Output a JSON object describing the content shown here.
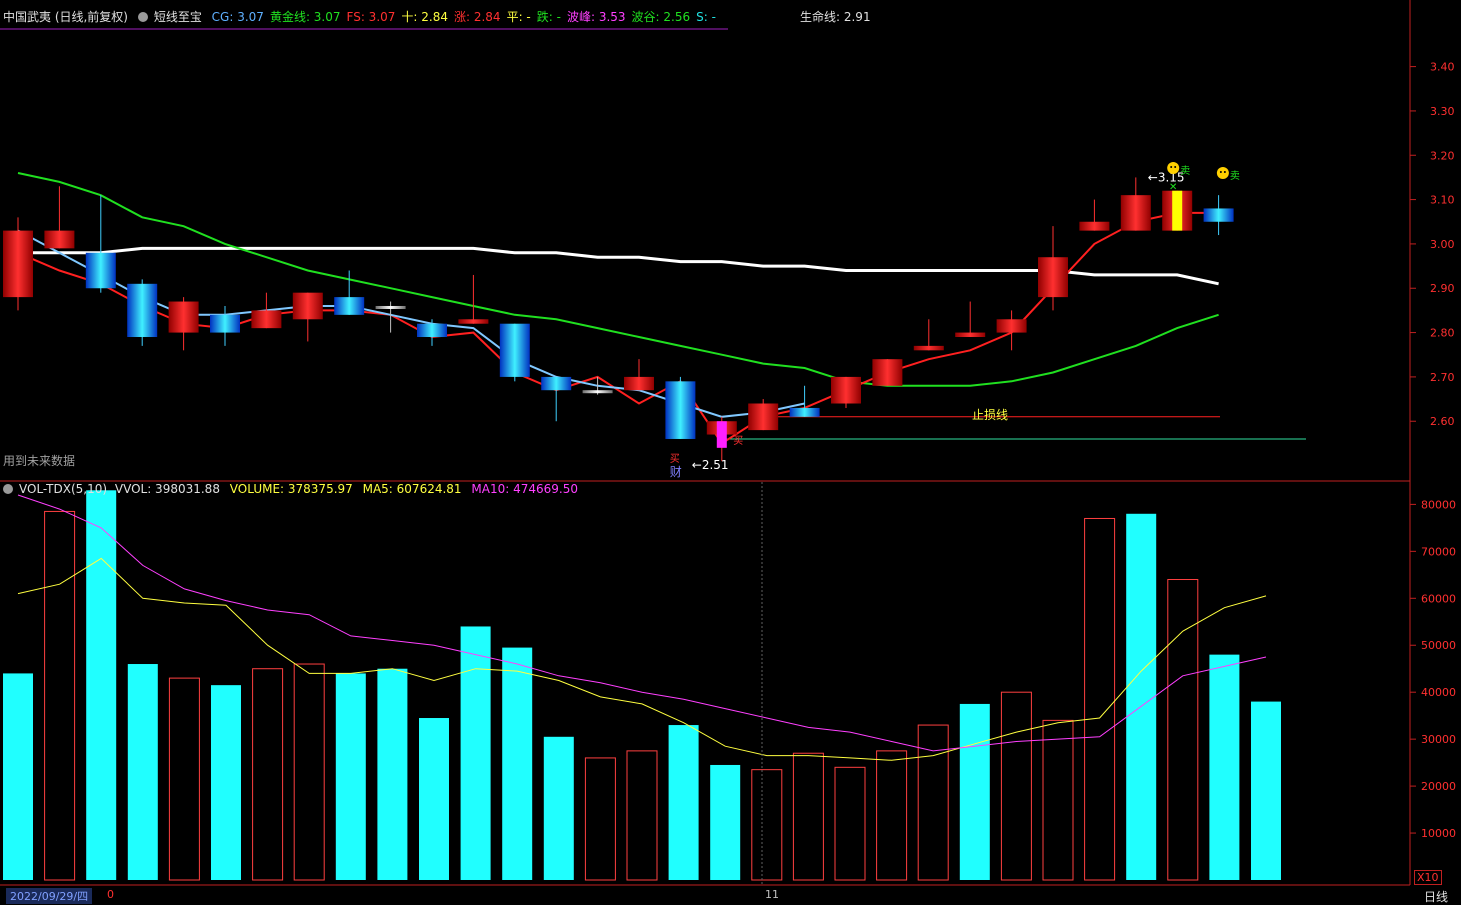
{
  "price_panel": {
    "stock_title": "中国武夷 (日线,前复权)",
    "indicator_name": "短线至宝",
    "fields": [
      {
        "label": "CG: 3.07",
        "color": "#5fb0ff"
      },
      {
        "label": "黄金线: 3.07",
        "color": "#20e020"
      },
      {
        "label": "FS: 3.07",
        "color": "#ff3030"
      },
      {
        "label": "十: 2.84",
        "color": "#ffff40"
      },
      {
        "label": "涨: 2.84",
        "color": "#ff3030"
      },
      {
        "label": "平: -",
        "color": "#ffff40"
      },
      {
        "label": "跌: -",
        "color": "#20e020"
      },
      {
        "label": "波峰: 3.53",
        "color": "#ff40ff"
      },
      {
        "label": "波谷: 2.56",
        "color": "#20e020"
      },
      {
        "label": "S: -",
        "color": "#20e0e0"
      }
    ],
    "lifeline": "生命线: 2.91",
    "future_data_note": "用到未来数据",
    "stop_loss_label": "止损线",
    "low_label": "2.51",
    "high_label": "3.15",
    "cai_label": "财",
    "buy_glyph": "买",
    "sell_glyph": "卖"
  },
  "volume_panel": {
    "name": "VOL-TDX(5,10)",
    "vvol": "VVOL: 398031.88",
    "volume": "VOLUME: 378375.97",
    "ma5": "MA5: 607624.81",
    "ma10": "MA10: 474669.50"
  },
  "bottom_bar": {
    "date_label": "2022/09/29/四",
    "zero_label": "0",
    "month_label": "11",
    "x10_label": "X10",
    "period_tab": "日线"
  },
  "colors": {
    "up": "#ff2020",
    "down": "#00ffff",
    "ma_short": "#80c8ff",
    "ma_green": "#20e020",
    "ma_white": "#ffffff",
    "ma_red": "#ff2020",
    "vol_ma5": "#ffff40",
    "vol_ma10": "#ff40ff",
    "axis": "#c02020"
  },
  "chart_data": [
    {
      "type": "candlestick",
      "title": "中国武夷 (日线,前复权)",
      "ylim": [
        2.49,
        3.46
      ],
      "y_ticks": [
        3.4,
        3.3,
        3.2,
        3.1,
        3.0,
        2.9,
        2.8,
        2.7,
        2.6
      ],
      "candles": [
        {
          "o": 2.88,
          "c": 3.03,
          "h": 3.06,
          "l": 2.85
        },
        {
          "o": 2.99,
          "c": 3.03,
          "h": 3.13,
          "l": 2.99
        },
        {
          "o": 2.98,
          "c": 2.9,
          "h": 3.11,
          "l": 2.89
        },
        {
          "o": 2.91,
          "c": 2.79,
          "h": 2.92,
          "l": 2.77
        },
        {
          "o": 2.8,
          "c": 2.87,
          "h": 2.88,
          "l": 2.76
        },
        {
          "o": 2.84,
          "c": 2.8,
          "h": 2.86,
          "l": 2.77
        },
        {
          "o": 2.81,
          "c": 2.85,
          "h": 2.89,
          "l": 2.81
        },
        {
          "o": 2.83,
          "c": 2.89,
          "h": 2.89,
          "l": 2.78
        },
        {
          "o": 2.88,
          "c": 2.84,
          "h": 2.94,
          "l": 2.84
        },
        {
          "o": 2.86,
          "c": 2.86,
          "h": 2.87,
          "l": 2.8
        },
        {
          "o": 2.82,
          "c": 2.79,
          "h": 2.83,
          "l": 2.77
        },
        {
          "o": 2.82,
          "c": 2.83,
          "h": 2.93,
          "l": 2.82
        },
        {
          "o": 2.82,
          "c": 2.7,
          "h": 2.82,
          "l": 2.69
        },
        {
          "o": 2.7,
          "c": 2.67,
          "h": 2.7,
          "l": 2.6
        },
        {
          "o": 2.67,
          "c": 2.67,
          "h": 2.7,
          "l": 2.66
        },
        {
          "o": 2.67,
          "c": 2.7,
          "h": 2.74,
          "l": 2.67
        },
        {
          "o": 2.69,
          "c": 2.56,
          "h": 2.7,
          "l": 2.56
        },
        {
          "o": 2.57,
          "c": 2.6,
          "h": 2.61,
          "l": 2.51
        },
        {
          "o": 2.58,
          "c": 2.64,
          "h": 2.65,
          "l": 2.58
        },
        {
          "o": 2.63,
          "c": 2.61,
          "h": 2.68,
          "l": 2.61
        },
        {
          "o": 2.64,
          "c": 2.7,
          "h": 2.7,
          "l": 2.63
        },
        {
          "o": 2.68,
          "c": 2.74,
          "h": 2.74,
          "l": 2.68
        },
        {
          "o": 2.76,
          "c": 2.77,
          "h": 2.83,
          "l": 2.76
        },
        {
          "o": 2.79,
          "c": 2.8,
          "h": 2.87,
          "l": 2.79
        },
        {
          "o": 2.8,
          "c": 2.83,
          "h": 2.85,
          "l": 2.76
        },
        {
          "o": 2.88,
          "c": 2.97,
          "h": 3.04,
          "l": 2.85
        },
        {
          "o": 3.03,
          "c": 3.05,
          "h": 3.1,
          "l": 3.03
        },
        {
          "o": 3.03,
          "c": 3.11,
          "h": 3.15,
          "l": 3.03
        },
        {
          "o": 3.03,
          "c": 3.12,
          "h": 3.12,
          "l": 3.03
        },
        {
          "o": 3.08,
          "c": 3.05,
          "h": 3.11,
          "l": 3.02
        }
      ],
      "lines": [
        {
          "name": "白线",
          "values": [
            2.98,
            2.98,
            2.98,
            2.99,
            2.99,
            2.99,
            2.99,
            2.99,
            2.99,
            2.99,
            2.99,
            2.99,
            2.98,
            2.98,
            2.97,
            2.97,
            2.96,
            2.96,
            2.95,
            2.95,
            2.94,
            2.94,
            2.94,
            2.94,
            2.94,
            2.94,
            2.93,
            2.93,
            2.93,
            2.91
          ]
        },
        {
          "name": "绿线",
          "values": [
            3.16,
            3.14,
            3.11,
            3.06,
            3.04,
            3.0,
            2.97,
            2.94,
            2.92,
            2.9,
            2.88,
            2.86,
            2.84,
            2.83,
            2.81,
            2.79,
            2.77,
            2.75,
            2.73,
            2.72,
            2.69,
            2.68,
            2.68,
            2.68,
            2.69,
            2.71,
            2.74,
            2.77,
            2.81,
            2.84
          ]
        },
        {
          "name": "红线",
          "values": [
            2.98,
            2.94,
            2.91,
            2.86,
            2.82,
            2.81,
            2.84,
            2.85,
            2.85,
            2.84,
            2.79,
            2.8,
            2.71,
            2.67,
            2.7,
            2.64,
            2.69,
            2.55,
            2.61,
            2.63,
            2.67,
            2.71,
            2.74,
            2.76,
            2.8,
            2.9,
            3.0,
            3.05,
            3.07,
            3.07
          ]
        },
        {
          "name": "蓝线",
          "values": [
            3.03,
            2.98,
            2.93,
            2.88,
            2.84,
            2.84,
            2.85,
            2.86,
            2.86,
            2.84,
            2.82,
            2.81,
            2.74,
            2.7,
            2.68,
            2.67,
            2.64,
            2.61,
            2.62,
            2.64
          ]
        }
      ],
      "stop_loss": 2.61,
      "support": 2.56
    },
    {
      "type": "bar",
      "title": "VOL-TDX(5,10)",
      "ylim": [
        0,
        82000
      ],
      "y_ticks": [
        80000,
        70000,
        60000,
        50000,
        40000,
        30000,
        20000,
        10000
      ],
      "values": [
        44000,
        78500,
        83000,
        46000,
        43000,
        41500,
        45000,
        46000,
        44000,
        45000,
        34500,
        54000,
        49500,
        30500,
        26000,
        27500,
        33000,
        24500,
        23500,
        27000,
        24000,
        27500,
        33000,
        37500,
        40000,
        34000,
        77000,
        78000,
        64000,
        48000,
        38000
      ],
      "up": [
        false,
        true,
        false,
        false,
        true,
        false,
        true,
        true,
        false,
        false,
        false,
        false,
        false,
        false,
        true,
        true,
        false,
        false,
        true,
        true,
        true,
        true,
        true,
        false,
        true,
        true,
        true,
        false,
        true,
        false,
        false
      ],
      "series": [
        {
          "name": "MA5",
          "values": [
            61000,
            63000,
            68500,
            60000,
            59000,
            58500,
            50000,
            44000,
            44000,
            45000,
            42500,
            45000,
            44500,
            42500,
            39000,
            37500,
            33500,
            28500,
            26500,
            26500,
            26000,
            25500,
            26500,
            29000,
            31500,
            33500,
            34500,
            44500,
            53000,
            58000,
            60500
          ]
        },
        {
          "name": "MA10",
          "values": [
            82000,
            79000,
            75000,
            67000,
            62000,
            59500,
            57500,
            56500,
            52000,
            51000,
            50000,
            48000,
            46000,
            43500,
            42000,
            40000,
            38500,
            36500,
            34500,
            32500,
            31500,
            29500,
            27500,
            28500,
            29500,
            30000,
            30500,
            37000,
            43500,
            45500,
            47500
          ]
        }
      ]
    }
  ]
}
